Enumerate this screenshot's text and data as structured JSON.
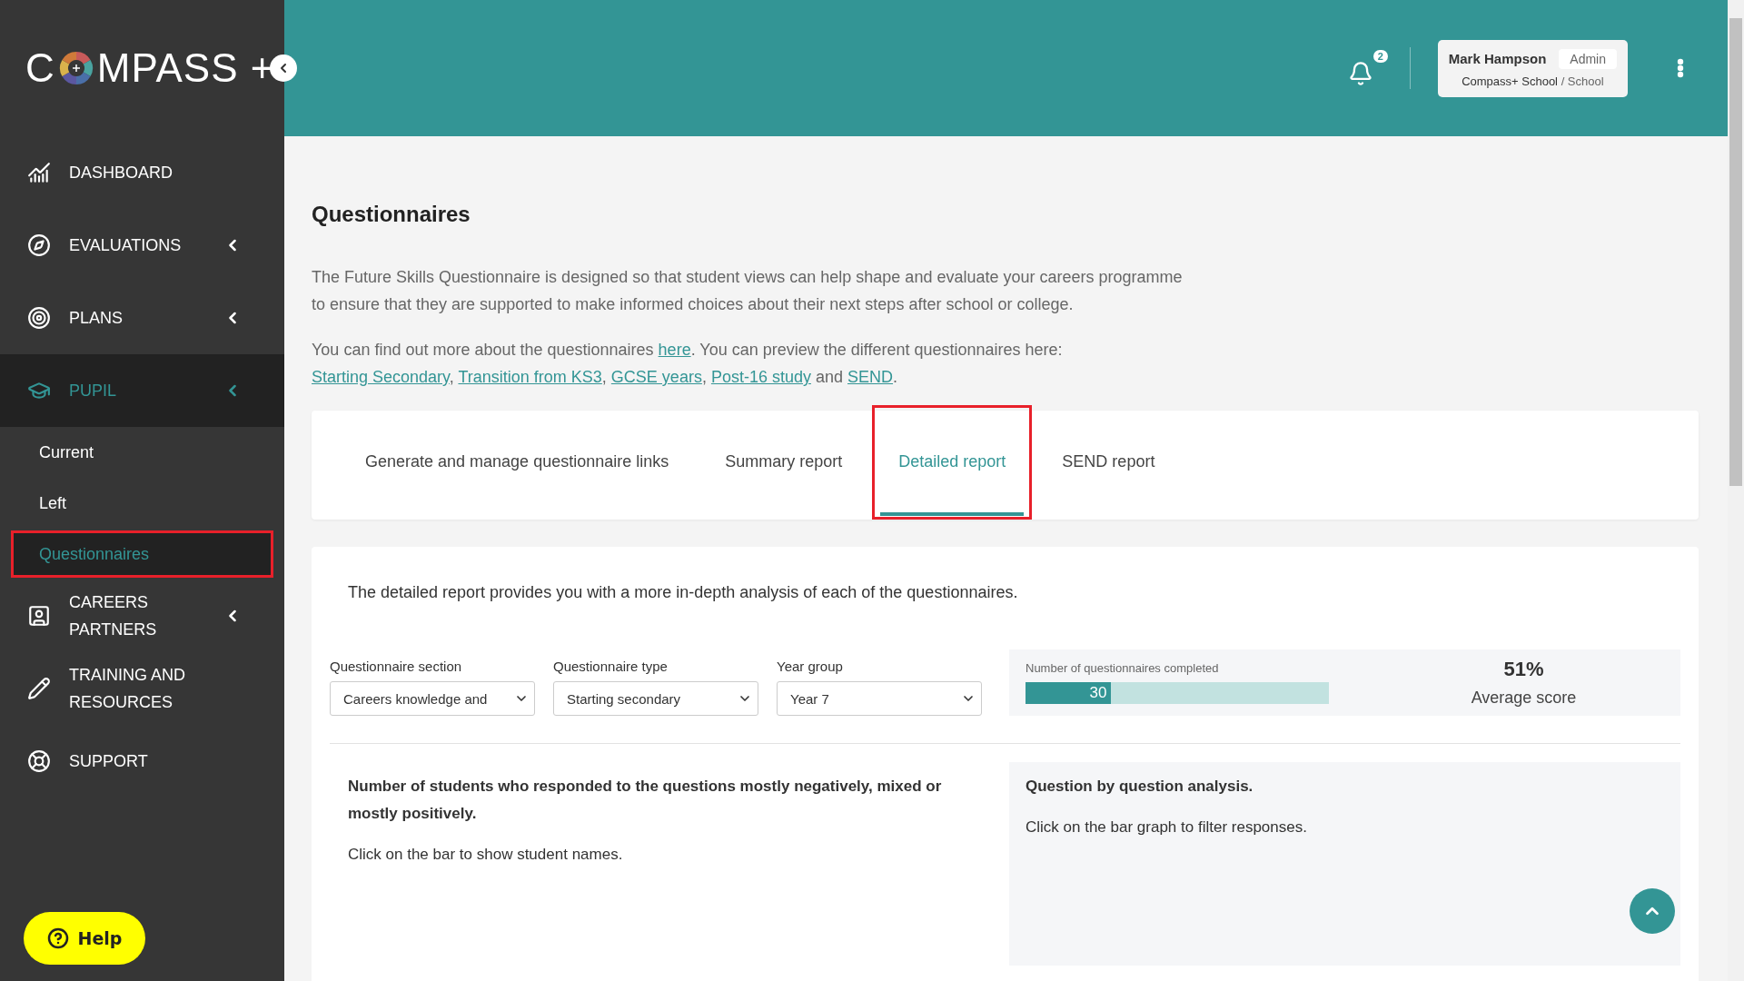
{
  "logo": {
    "before": "C",
    "after": "MPASS",
    "plus": "+"
  },
  "sidebar": {
    "items": [
      {
        "label": "DASHBOARD",
        "kind": "link",
        "selected": false
      },
      {
        "label": "EVALUATIONS",
        "kind": "menu",
        "selected": false
      },
      {
        "label": "PLANS",
        "kind": "menu",
        "selected": false
      },
      {
        "label": "PUPIL",
        "kind": "menu",
        "selected": true,
        "children": [
          {
            "label": "Current",
            "selected": false,
            "highlighted": false
          },
          {
            "label": "Left",
            "selected": false,
            "highlighted": false
          },
          {
            "label": "Questionnaires",
            "selected": true,
            "highlighted": true
          }
        ]
      },
      {
        "label": "CAREERS PARTNERS",
        "kind": "menu",
        "selected": false
      },
      {
        "label": "TRAINING AND RESOURCES",
        "kind": "link",
        "selected": false
      },
      {
        "label": "SUPPORT",
        "kind": "link",
        "selected": false
      }
    ],
    "help_button": "Help"
  },
  "header": {
    "notifications": "2",
    "user": {
      "name": "Mark Hampson",
      "role": "Admin",
      "school": "Compass+ School",
      "type": "/ School"
    }
  },
  "page": {
    "title": "Questionnaires",
    "intro": "The Future Skills Questionnaire is designed so that student views can help shape and evaluate your careers programme to ensure that they are supported to make informed choices about their next steps after school or college.",
    "preview": [
      {
        "kind": "text",
        "text": "You can find out more about the questionnaires "
      },
      {
        "kind": "link",
        "text": "here"
      },
      {
        "kind": "text",
        "text": ". You can preview the different questionnaires here: "
      },
      {
        "kind": "link",
        "text": "Starting Secondary"
      },
      {
        "kind": "text",
        "text": ", "
      },
      {
        "kind": "link",
        "text": "Transition from KS3"
      },
      {
        "kind": "text",
        "text": ", "
      },
      {
        "kind": "link",
        "text": "GCSE years"
      },
      {
        "kind": "text",
        "text": ", "
      },
      {
        "kind": "link",
        "text": "Post-16 study"
      },
      {
        "kind": "text",
        "text": " and "
      },
      {
        "kind": "link",
        "text": "SEND"
      },
      {
        "kind": "text",
        "text": "."
      }
    ]
  },
  "tabs": [
    {
      "label": "Generate and manage questionnaire links",
      "selected": false,
      "highlighted": false
    },
    {
      "label": "Summary report",
      "selected": false,
      "highlighted": false
    },
    {
      "label": "Detailed report",
      "selected": true,
      "highlighted": true
    },
    {
      "label": "SEND report",
      "selected": false,
      "highlighted": false
    }
  ],
  "report": {
    "description": "The detailed report provides you with a more in-depth analysis of each of the questionnaires.",
    "filters": [
      {
        "label": "Questionnaire section",
        "value": "Careers knowledge and"
      },
      {
        "label": "Questionnaire type",
        "value": "Starting secondary"
      },
      {
        "label": "Year group",
        "value": "Year 7"
      }
    ],
    "completed": {
      "label": "Number of questionnaires completed",
      "count": "30",
      "level": 0.28
    },
    "average": {
      "value": "51%",
      "label": "Average score"
    },
    "left_panel": {
      "heading": "Number of students who responded to the questions mostly negatively, mixed or mostly positively.",
      "hint": "Click on the bar to show student names."
    },
    "right_panel": {
      "heading": "Question by question analysis.",
      "hint": "Click on the bar graph to filter responses."
    }
  }
}
